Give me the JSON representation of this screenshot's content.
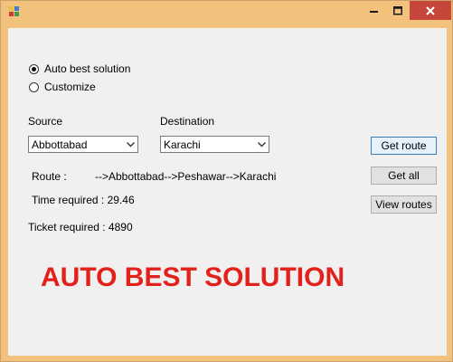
{
  "window": {
    "controls": {
      "minimize": "—",
      "maximize": "☐",
      "close": "✕"
    },
    "colors": {
      "frame": "#f2c27d",
      "close": "#c7463b",
      "accent": "#e3211b"
    }
  },
  "mode": {
    "options": [
      {
        "label": "Auto best solution",
        "checked": true
      },
      {
        "label": "Customize",
        "checked": false
      }
    ]
  },
  "source": {
    "label": "Source",
    "value": "Abbottabad"
  },
  "destination": {
    "label": "Destination",
    "value": "Karachi"
  },
  "buttons": {
    "get_route": "Get route",
    "get_all": "Get all",
    "view_routes": "View routes"
  },
  "result": {
    "route_label": "Route :",
    "route_value": "-->Abbottabad-->Peshawar-->Karachi",
    "time": "Time required : 29.46",
    "ticket": "Ticket required : 4890"
  },
  "banner": "AUTO BEST SOLUTION"
}
